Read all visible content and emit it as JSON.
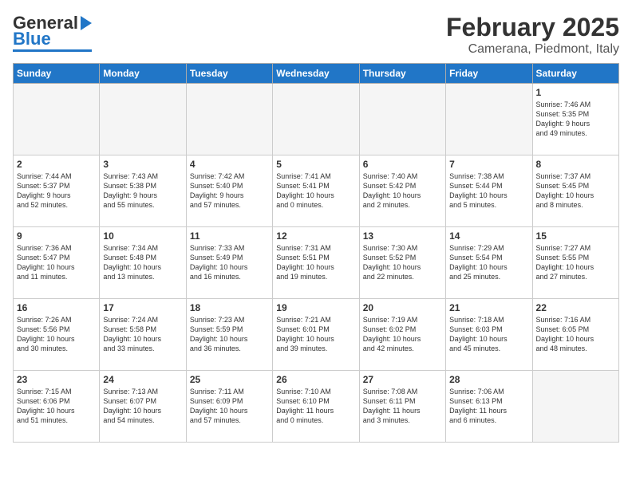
{
  "header": {
    "logo_general": "General",
    "logo_blue": "Blue",
    "month_year": "February 2025",
    "location": "Camerana, Piedmont, Italy"
  },
  "days_of_week": [
    "Sunday",
    "Monday",
    "Tuesday",
    "Wednesday",
    "Thursday",
    "Friday",
    "Saturday"
  ],
  "weeks": [
    [
      {
        "num": "",
        "info": ""
      },
      {
        "num": "",
        "info": ""
      },
      {
        "num": "",
        "info": ""
      },
      {
        "num": "",
        "info": ""
      },
      {
        "num": "",
        "info": ""
      },
      {
        "num": "",
        "info": ""
      },
      {
        "num": "1",
        "info": "Sunrise: 7:46 AM\nSunset: 5:35 PM\nDaylight: 9 hours\nand 49 minutes."
      }
    ],
    [
      {
        "num": "2",
        "info": "Sunrise: 7:44 AM\nSunset: 5:37 PM\nDaylight: 9 hours\nand 52 minutes."
      },
      {
        "num": "3",
        "info": "Sunrise: 7:43 AM\nSunset: 5:38 PM\nDaylight: 9 hours\nand 55 minutes."
      },
      {
        "num": "4",
        "info": "Sunrise: 7:42 AM\nSunset: 5:40 PM\nDaylight: 9 hours\nand 57 minutes."
      },
      {
        "num": "5",
        "info": "Sunrise: 7:41 AM\nSunset: 5:41 PM\nDaylight: 10 hours\nand 0 minutes."
      },
      {
        "num": "6",
        "info": "Sunrise: 7:40 AM\nSunset: 5:42 PM\nDaylight: 10 hours\nand 2 minutes."
      },
      {
        "num": "7",
        "info": "Sunrise: 7:38 AM\nSunset: 5:44 PM\nDaylight: 10 hours\nand 5 minutes."
      },
      {
        "num": "8",
        "info": "Sunrise: 7:37 AM\nSunset: 5:45 PM\nDaylight: 10 hours\nand 8 minutes."
      }
    ],
    [
      {
        "num": "9",
        "info": "Sunrise: 7:36 AM\nSunset: 5:47 PM\nDaylight: 10 hours\nand 11 minutes."
      },
      {
        "num": "10",
        "info": "Sunrise: 7:34 AM\nSunset: 5:48 PM\nDaylight: 10 hours\nand 13 minutes."
      },
      {
        "num": "11",
        "info": "Sunrise: 7:33 AM\nSunset: 5:49 PM\nDaylight: 10 hours\nand 16 minutes."
      },
      {
        "num": "12",
        "info": "Sunrise: 7:31 AM\nSunset: 5:51 PM\nDaylight: 10 hours\nand 19 minutes."
      },
      {
        "num": "13",
        "info": "Sunrise: 7:30 AM\nSunset: 5:52 PM\nDaylight: 10 hours\nand 22 minutes."
      },
      {
        "num": "14",
        "info": "Sunrise: 7:29 AM\nSunset: 5:54 PM\nDaylight: 10 hours\nand 25 minutes."
      },
      {
        "num": "15",
        "info": "Sunrise: 7:27 AM\nSunset: 5:55 PM\nDaylight: 10 hours\nand 27 minutes."
      }
    ],
    [
      {
        "num": "16",
        "info": "Sunrise: 7:26 AM\nSunset: 5:56 PM\nDaylight: 10 hours\nand 30 minutes."
      },
      {
        "num": "17",
        "info": "Sunrise: 7:24 AM\nSunset: 5:58 PM\nDaylight: 10 hours\nand 33 minutes."
      },
      {
        "num": "18",
        "info": "Sunrise: 7:23 AM\nSunset: 5:59 PM\nDaylight: 10 hours\nand 36 minutes."
      },
      {
        "num": "19",
        "info": "Sunrise: 7:21 AM\nSunset: 6:01 PM\nDaylight: 10 hours\nand 39 minutes."
      },
      {
        "num": "20",
        "info": "Sunrise: 7:19 AM\nSunset: 6:02 PM\nDaylight: 10 hours\nand 42 minutes."
      },
      {
        "num": "21",
        "info": "Sunrise: 7:18 AM\nSunset: 6:03 PM\nDaylight: 10 hours\nand 45 minutes."
      },
      {
        "num": "22",
        "info": "Sunrise: 7:16 AM\nSunset: 6:05 PM\nDaylight: 10 hours\nand 48 minutes."
      }
    ],
    [
      {
        "num": "23",
        "info": "Sunrise: 7:15 AM\nSunset: 6:06 PM\nDaylight: 10 hours\nand 51 minutes."
      },
      {
        "num": "24",
        "info": "Sunrise: 7:13 AM\nSunset: 6:07 PM\nDaylight: 10 hours\nand 54 minutes."
      },
      {
        "num": "25",
        "info": "Sunrise: 7:11 AM\nSunset: 6:09 PM\nDaylight: 10 hours\nand 57 minutes."
      },
      {
        "num": "26",
        "info": "Sunrise: 7:10 AM\nSunset: 6:10 PM\nDaylight: 11 hours\nand 0 minutes."
      },
      {
        "num": "27",
        "info": "Sunrise: 7:08 AM\nSunset: 6:11 PM\nDaylight: 11 hours\nand 3 minutes."
      },
      {
        "num": "28",
        "info": "Sunrise: 7:06 AM\nSunset: 6:13 PM\nDaylight: 11 hours\nand 6 minutes."
      },
      {
        "num": "",
        "info": ""
      }
    ]
  ]
}
